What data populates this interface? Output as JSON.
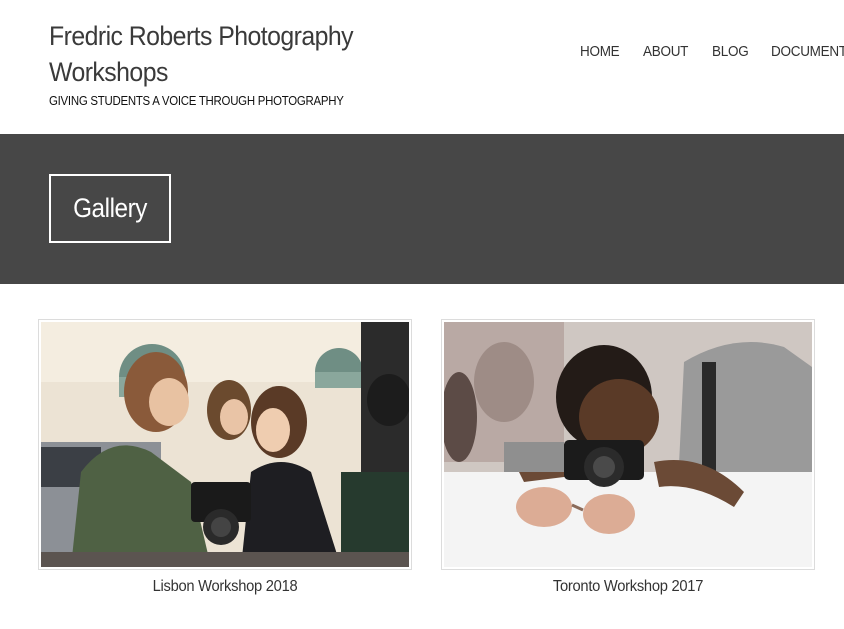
{
  "site": {
    "title": "Fredric Roberts Photography Workshops",
    "tagline": "GIVING STUDENTS A VOICE THROUGH PHOTOGRAPHY"
  },
  "nav": {
    "items": [
      {
        "label": "HOME"
      },
      {
        "label": "ABOUT"
      },
      {
        "label": "BLOG"
      },
      {
        "label": "DOCUMENT"
      }
    ]
  },
  "banner": {
    "title": "Gallery"
  },
  "gallery": {
    "items": [
      {
        "caption": "Lisbon Workshop 2018",
        "image": "students-with-camera-photo"
      },
      {
        "caption": "Toronto Workshop 2017",
        "image": "student-photographing-photo"
      }
    ]
  },
  "colors": {
    "banner_bg": "#474747",
    "text": "#333333",
    "white": "#ffffff"
  }
}
